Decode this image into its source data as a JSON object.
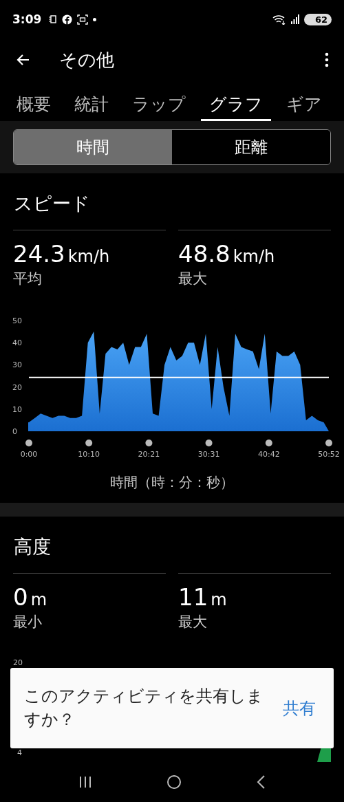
{
  "status_bar": {
    "time": "3:09",
    "battery": "62"
  },
  "header": {
    "title": "その他"
  },
  "tabs": [
    {
      "label": "概要",
      "selected": false
    },
    {
      "label": "統計",
      "selected": false
    },
    {
      "label": "ラップ",
      "selected": false
    },
    {
      "label": "グラフ",
      "selected": true
    },
    {
      "label": "ギア",
      "selected": false
    }
  ],
  "segments": [
    {
      "label": "時間",
      "selected": true
    },
    {
      "label": "距離",
      "selected": false
    }
  ],
  "speed": {
    "title": "スピード",
    "stats": [
      {
        "value": "24.3",
        "unit": "km/h",
        "label": "平均"
      },
      {
        "value": "48.8",
        "unit": "km/h",
        "label": "最大"
      }
    ],
    "chart_data": {
      "type": "area",
      "xlabel": "時間（時：分：秒）",
      "ylim": [
        0,
        50
      ],
      "yticks": [
        0,
        10,
        20,
        30,
        40,
        50
      ],
      "xlim": [
        0,
        50.87
      ],
      "xticks": [
        {
          "value": 0,
          "label": "0:00"
        },
        {
          "value": 10.17,
          "label": "10:10"
        },
        {
          "value": 20.35,
          "label": "20:21"
        },
        {
          "value": 30.52,
          "label": "30:31"
        },
        {
          "value": 40.7,
          "label": "40:42"
        },
        {
          "value": 50.87,
          "label": "50:52"
        }
      ],
      "x": [
        0,
        1,
        2,
        3,
        4,
        5,
        6,
        7,
        8,
        9,
        10,
        11,
        12,
        13,
        14,
        15,
        16,
        17,
        18,
        19,
        20,
        21,
        22,
        23,
        24,
        25,
        26,
        27,
        28,
        29,
        30,
        31,
        32,
        33,
        34,
        35,
        36,
        37,
        38,
        39,
        40,
        41,
        42,
        43,
        44,
        45,
        46,
        47,
        48,
        49,
        50,
        50.87
      ],
      "values": [
        4,
        6,
        8,
        7,
        6,
        7,
        7,
        6,
        6,
        7,
        40,
        45,
        8,
        35,
        38,
        37,
        40,
        30,
        38,
        38,
        44,
        8,
        7,
        30,
        38,
        32,
        34,
        40,
        40,
        30,
        44,
        10,
        38,
        20,
        7,
        44,
        38,
        37,
        36,
        28,
        44,
        8,
        36,
        34,
        34,
        36,
        30,
        5,
        7,
        5,
        4,
        0
      ],
      "ref_lines": [
        {
          "axis": "y",
          "value": 24.3
        }
      ]
    }
  },
  "altitude": {
    "title": "高度",
    "stats": [
      {
        "value": "0",
        "unit": "m",
        "label": "最小"
      },
      {
        "value": "11",
        "unit": "m",
        "label": "最大"
      }
    ],
    "axis_labels": [
      "20",
      "4"
    ]
  },
  "toast": {
    "message": "このアクティビティを共有しますか？",
    "action": "共有"
  }
}
